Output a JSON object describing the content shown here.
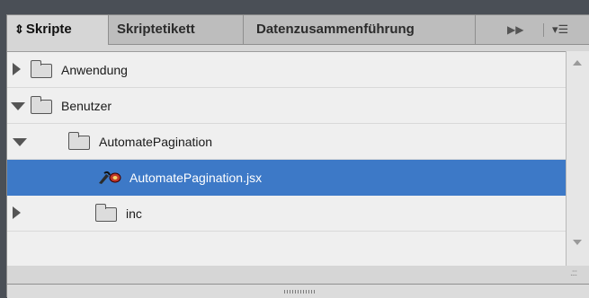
{
  "tabs": [
    {
      "label": "Skripte",
      "active": true,
      "icon": "up-down-arrows-icon"
    },
    {
      "label": "Skriptetikett",
      "active": false
    },
    {
      "label": "Datenzusammenführung",
      "active": false
    }
  ],
  "tabbar": {
    "overflow_icon": "double-chevron-right-icon",
    "menu_icon": "panel-menu-icon"
  },
  "tree": [
    {
      "label": "Anwendung",
      "expanded": false,
      "type": "folder"
    },
    {
      "label": "Benutzer",
      "expanded": true,
      "type": "folder"
    },
    {
      "label": "AutomatePagination",
      "expanded": true,
      "type": "folder"
    },
    {
      "label": "AutomatePagination.jsx",
      "type": "script",
      "selected": true,
      "icon": "script-file-icon"
    },
    {
      "label": "inc",
      "expanded": false,
      "type": "folder"
    }
  ],
  "colors": {
    "selection": "#3d79c7",
    "background": "#efefef",
    "chrome": "#4a4f56"
  }
}
